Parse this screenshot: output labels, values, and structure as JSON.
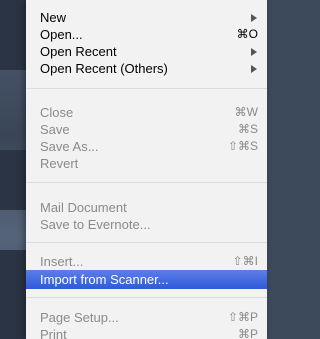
{
  "menu": {
    "group1": [
      {
        "label": "New",
        "shortcut": "",
        "submenu": true,
        "enabled": true
      },
      {
        "label": "Open...",
        "shortcut": "⌘O",
        "submenu": false,
        "enabled": true
      },
      {
        "label": "Open Recent",
        "shortcut": "",
        "submenu": true,
        "enabled": true
      },
      {
        "label": "Open Recent (Others)",
        "shortcut": "",
        "submenu": true,
        "enabled": true
      }
    ],
    "group2": [
      {
        "label": "Close",
        "shortcut": "⌘W",
        "enabled": false
      },
      {
        "label": "Save",
        "shortcut": "⌘S",
        "enabled": false
      },
      {
        "label": "Save As...",
        "shortcut": "⇧⌘S",
        "enabled": false
      },
      {
        "label": "Revert",
        "shortcut": "",
        "enabled": false
      }
    ],
    "group3": [
      {
        "label": "Mail Document",
        "shortcut": "",
        "enabled": false
      },
      {
        "label": "Save to Evernote...",
        "shortcut": "",
        "enabled": false
      }
    ],
    "group4": [
      {
        "label": "Insert...",
        "shortcut": "⇧⌘I",
        "enabled": false
      },
      {
        "label": "Import from Scanner...",
        "shortcut": "",
        "enabled": true,
        "highlighted": true
      }
    ],
    "group5": [
      {
        "label": "Page Setup...",
        "shortcut": "⇧⌘P",
        "enabled": false
      },
      {
        "label": "Print",
        "shortcut": "⌘P",
        "enabled": false
      }
    ]
  },
  "colors": {
    "menu_background": "#f2f2f2",
    "highlight": "#2d5ad9",
    "disabled_text": "#8a8a8a"
  }
}
